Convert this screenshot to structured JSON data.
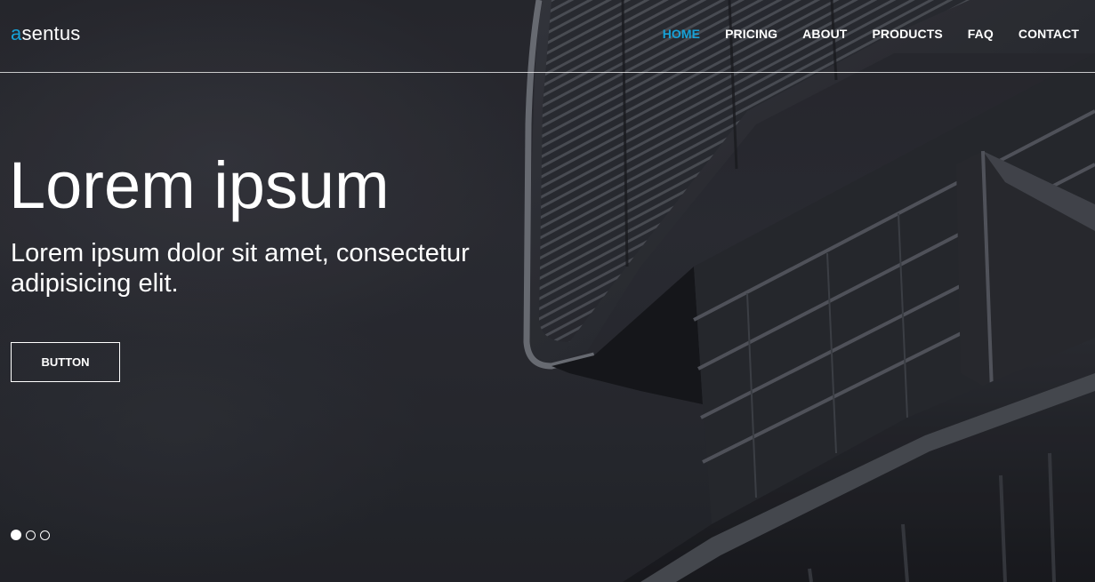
{
  "brand": {
    "logo_accent": "a",
    "logo_rest": "sentus",
    "accent_color": "#17a2d8"
  },
  "nav": {
    "items": [
      {
        "label": "HOME",
        "active": true
      },
      {
        "label": "PRICING",
        "active": false
      },
      {
        "label": "ABOUT",
        "active": false
      },
      {
        "label": "PRODUCTS",
        "active": false
      },
      {
        "label": "FAQ",
        "active": false
      },
      {
        "label": "CONTACT",
        "active": false
      }
    ]
  },
  "hero": {
    "title": "Lorem ipsum",
    "subtitle": "Lorem ipsum dolor sit amet, consectetur adipisicing elit.",
    "button_label": "BUTTON"
  },
  "slider": {
    "slide_count": 3,
    "active_index": 0
  }
}
